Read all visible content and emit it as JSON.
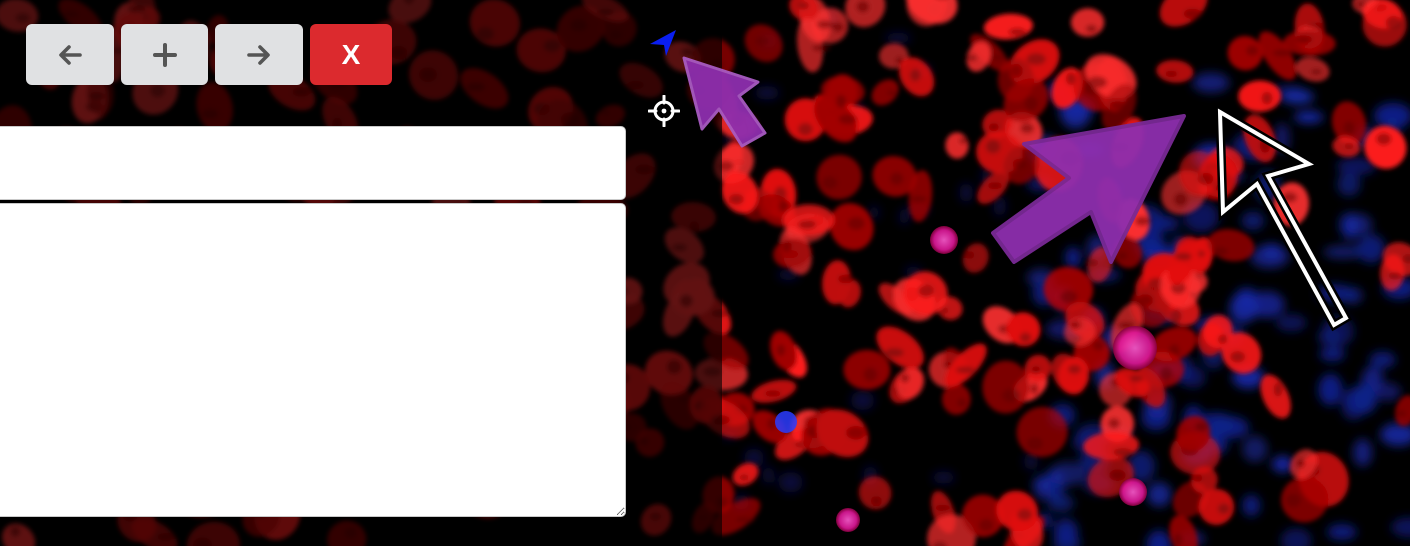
{
  "toolbar": {
    "back_icon": "arrow-left-icon",
    "add_icon": "plus-icon",
    "forward_icon": "arrow-right-icon",
    "close_label": "X"
  },
  "editor": {
    "title_value": "",
    "notes_value": ""
  },
  "tools": {
    "pointer_icon": "navigation-arrow-icon",
    "locate_icon": "crosshair-icon"
  },
  "colors": {
    "button_bg": "#e0e1e3",
    "close_bg": "#dc2a2e",
    "annotation_purple": "#8e2fae",
    "annotation_white": "#ffffff",
    "pointer_blue": "#0a1ef0",
    "nuclei_red": "#ff1a1a",
    "nuclei_blue": "#1a2aa8"
  },
  "annotations": [
    {
      "type": "arrow",
      "color": "purple",
      "style": "filled"
    },
    {
      "type": "arrow",
      "color": "purple",
      "style": "filled"
    },
    {
      "type": "arrow",
      "color": "white",
      "style": "outline"
    }
  ]
}
